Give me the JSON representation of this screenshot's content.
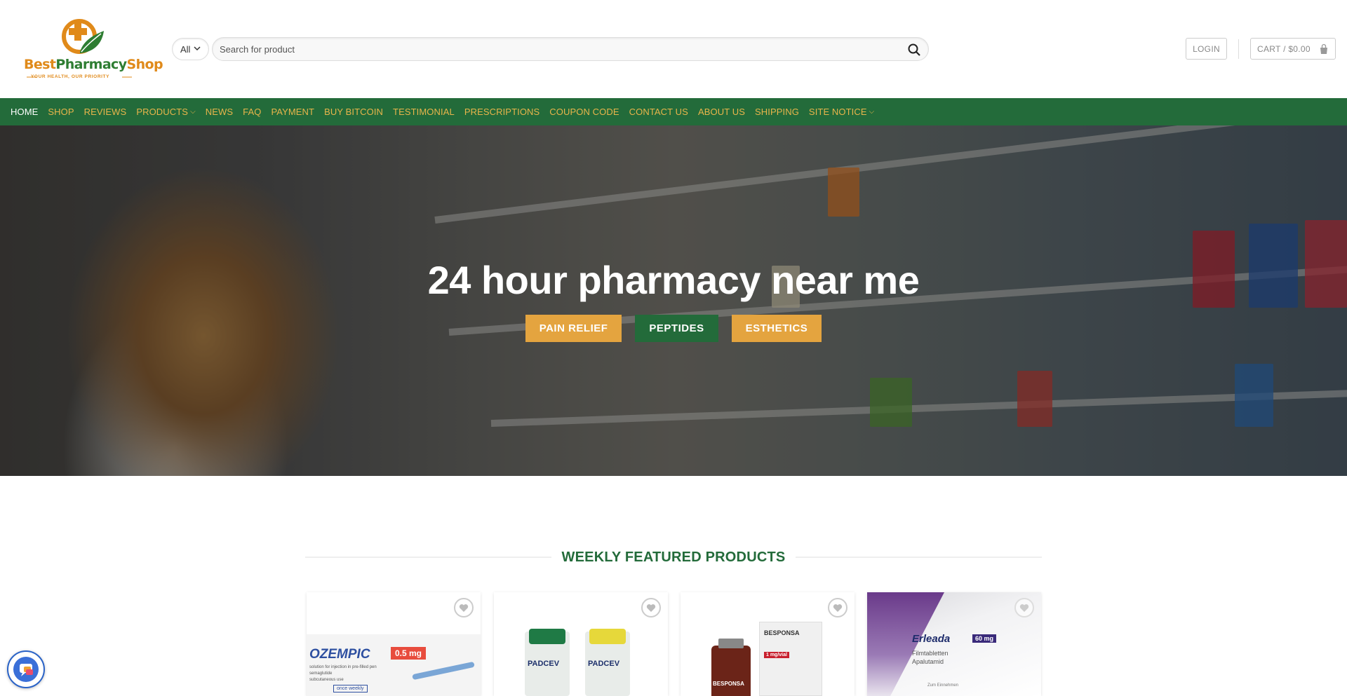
{
  "logo": {
    "name_part1": "Best",
    "name_part2": "Pharmacy",
    "name_part3": "Shop",
    "tagline": "YOUR HEALTH, OUR PRIORITY"
  },
  "search": {
    "category": "All",
    "placeholder": "Search for product"
  },
  "account": {
    "login_label": "LOGIN",
    "cart_label": "CART / $0.00"
  },
  "nav": {
    "items": [
      {
        "label": "HOME",
        "active": true
      },
      {
        "label": "SHOP"
      },
      {
        "label": "REVIEWS"
      },
      {
        "label": "PRODUCTS",
        "dropdown": true
      },
      {
        "label": "NEWS"
      },
      {
        "label": "FAQ"
      },
      {
        "label": "PAYMENT"
      },
      {
        "label": "BUY BITCOIN"
      },
      {
        "label": "TESTIMONIAL"
      },
      {
        "label": "PRESCRIPTIONS"
      },
      {
        "label": "COUPON CODE"
      },
      {
        "label": "CONTACT US"
      },
      {
        "label": "ABOUT US"
      },
      {
        "label": "SHIPPING"
      },
      {
        "label": "SITE NOTICE",
        "dropdown": true
      }
    ]
  },
  "hero": {
    "title": "24 hour pharmacy near me",
    "buttons": [
      {
        "label": "PAIN RELIEF",
        "color": "#e4a43f"
      },
      {
        "label": "PEPTIDES",
        "color": "#236b3a"
      },
      {
        "label": "ESTHETICS",
        "color": "#e4a43f"
      }
    ]
  },
  "featured": {
    "title": "WEEKLY FEATURED PRODUCTS",
    "products": [
      {
        "brand": "OZEMPIC",
        "dose": "0.5 mg",
        "line1": "solution for injection in pre-filled pen",
        "line2": "semaglutide",
        "line3": "subcutaneous use",
        "line4": "once weekly"
      },
      {
        "brand": "PADCEV",
        "brand2": "PADCEV"
      },
      {
        "brand": "BESPONSA",
        "dose": "1 mg/vial",
        "brand2": "BESPONSA"
      },
      {
        "brand": "Erleada",
        "dose": "60 mg",
        "line1": "Filmtabletten",
        "line2": "Apalutamid",
        "line3": "Zum Einnehmen"
      }
    ]
  },
  "colors": {
    "brand_green": "#236b3a",
    "brand_gold": "#e4a43f",
    "nav_link": "#e8b54b"
  }
}
